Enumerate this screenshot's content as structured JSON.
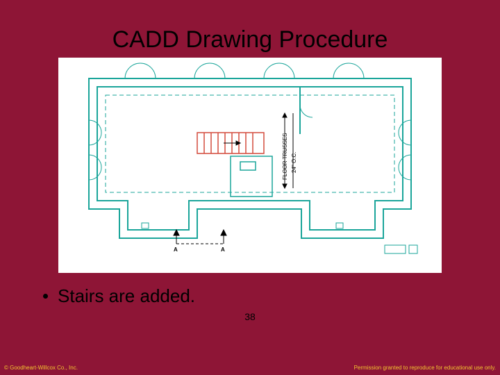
{
  "title": "CADD Drawing Procedure",
  "bullet": "Stairs are added.",
  "slide_number": "38",
  "copyright": "© Goodheart-Willcox Co., Inc.",
  "permission": "Permission granted to reproduce for educational use only.",
  "annotations": {
    "floor_trusses": "FLOOR TRUSSES",
    "spacing": "24\" O.C.",
    "section_a_left": "A",
    "section_a_right": "A"
  },
  "colors": {
    "background": "#8e1536",
    "cad_line": "#1aa59a",
    "accent": "#d34a3c",
    "footer_text": "#f4c430"
  }
}
